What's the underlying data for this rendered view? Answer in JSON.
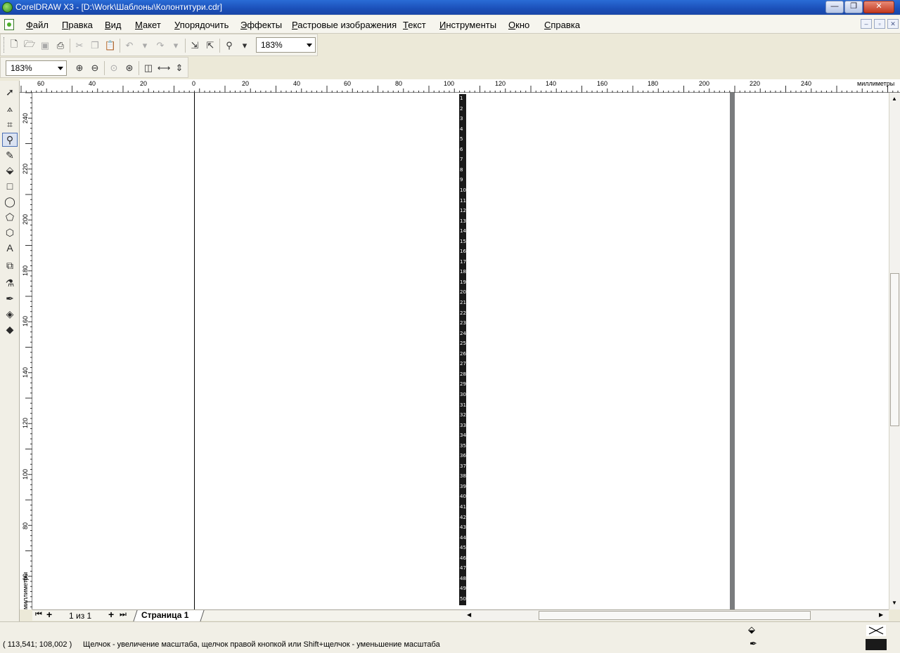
{
  "window": {
    "title": "CorelDRAW X3 - [D:\\Work\\Шаблоны\\Колонтитури.cdr]",
    "min_label": "—",
    "max_label": "❐",
    "close_label": "✕"
  },
  "menu": {
    "items": [
      "Файл",
      "Правка",
      "Вид",
      "Макет",
      "Упорядочить",
      "Эффекты",
      "Растровые изображения",
      "Текст",
      "Инструменты",
      "Окно",
      "Справка"
    ],
    "mdi_min": "–",
    "mdi_restore": "▫",
    "mdi_close": "✕"
  },
  "toolbar1": {
    "zoom_value": "183%"
  },
  "toolbar2": {
    "zoom_value": "183%"
  },
  "rulers": {
    "unit": "миллиметры",
    "h_labels": [
      "60",
      "40",
      "20",
      "0",
      "20",
      "40",
      "60",
      "80",
      "100",
      "120",
      "140",
      "160",
      "180",
      "200",
      "220",
      "240"
    ],
    "v_labels": [
      "240",
      "220",
      "200",
      "180",
      "160",
      "140",
      "120",
      "100",
      "80",
      "60"
    ]
  },
  "line_numbers": [
    "1",
    "2",
    "3",
    "4",
    "5",
    "6",
    "7",
    "8",
    "9",
    "10",
    "11",
    "12",
    "13",
    "14",
    "15",
    "16",
    "17",
    "18",
    "19",
    "20",
    "21",
    "22",
    "23",
    "24",
    "25",
    "26",
    "27",
    "28",
    "29",
    "30",
    "31",
    "32",
    "33",
    "34",
    "35",
    "36",
    "37",
    "38",
    "39",
    "40",
    "41",
    "42",
    "43",
    "44",
    "45",
    "46",
    "47",
    "48",
    "49",
    "50"
  ],
  "pages": {
    "counter": "1 из 1",
    "tab_label": "Страница 1"
  },
  "status": {
    "coords": "( 113,541; 108,002 )",
    "hint": "Щелчок - увеличение масштаба, щелчок правой кнопкой или Shift+щелчок - уменьшение масштаба"
  },
  "colors": {
    "title_bar": "#1f56c0",
    "canvas": "#ffffff",
    "outline_swatch": "#1a1a1a"
  }
}
